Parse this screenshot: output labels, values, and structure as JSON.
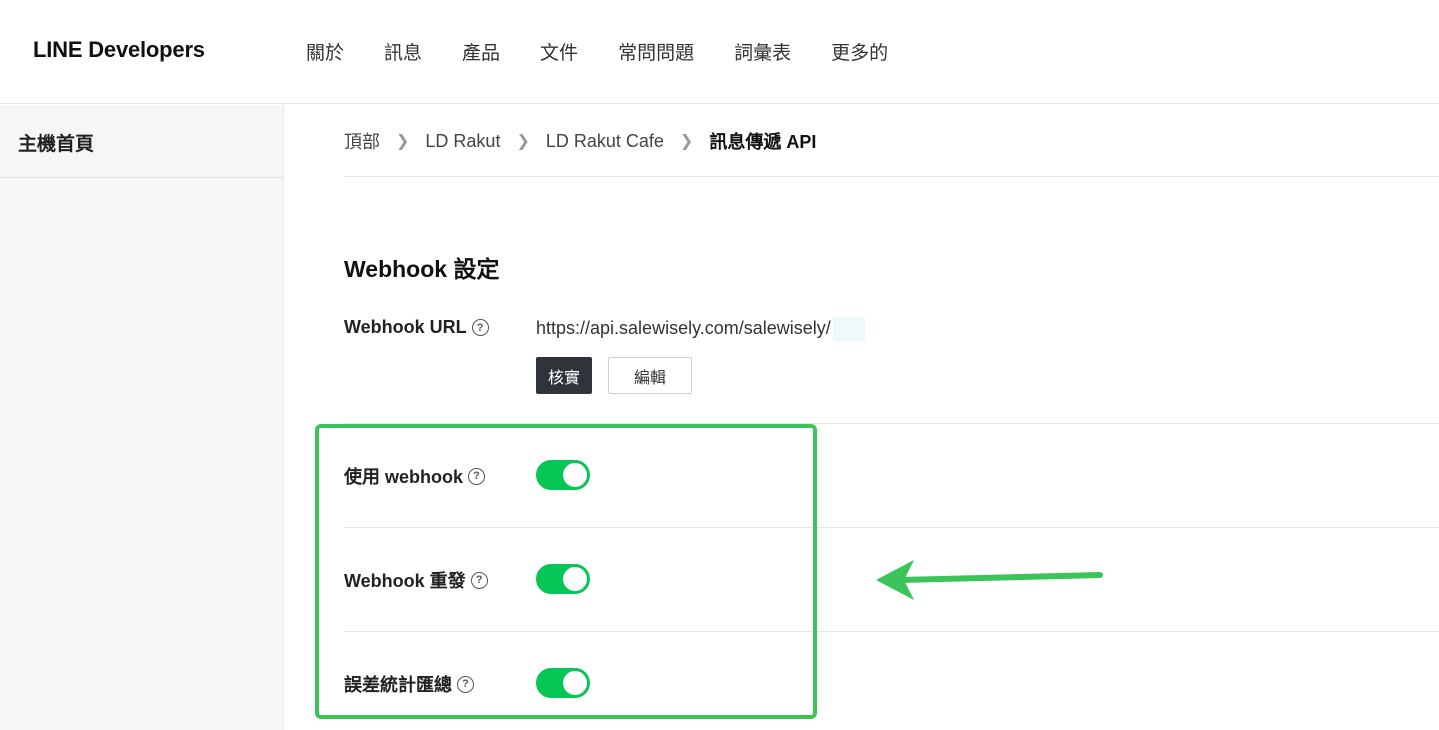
{
  "header": {
    "logo": "LINE Developers",
    "nav": [
      "關於",
      "訊息",
      "產品",
      "文件",
      "常問問題",
      "詞彙表",
      "更多的"
    ]
  },
  "sidebar": {
    "home": "主機首頁"
  },
  "breadcrumb": [
    "頂部",
    "LD Rakut",
    "LD Rakut Cafe",
    "訊息傳遞 API"
  ],
  "webhook": {
    "section_title": "Webhook 設定",
    "url_label": "Webhook URL",
    "url_value": "https://api.salewisely.com/salewisely/",
    "verify_button": "核實",
    "edit_button": "編輯",
    "use_webhook_label": "使用 webhook",
    "use_webhook_enabled": true,
    "redelivery_label": "Webhook 重發",
    "redelivery_enabled": true,
    "error_stats_label": "誤差統計匯總",
    "error_stats_enabled": true,
    "help_icon_glyph": "?"
  },
  "colors": {
    "toggle_on": "#06c755",
    "annotation": "#3cc45a",
    "verify_button_bg": "#2f343a"
  }
}
